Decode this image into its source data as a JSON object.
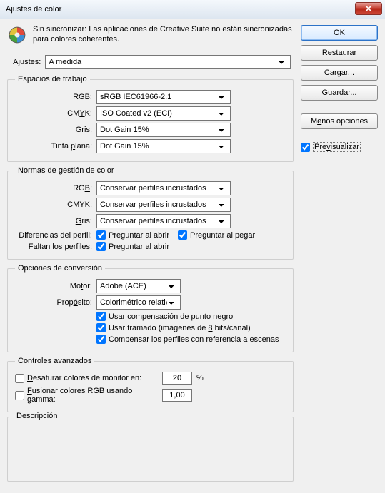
{
  "window": {
    "title": "Ajustes de color"
  },
  "sync": {
    "text": "Sin sincronizar: Las aplicaciones de Creative Suite no están sincronizadas para colores coherentes."
  },
  "settings": {
    "label": "Ajustes:",
    "value": "A medida"
  },
  "workspaces": {
    "legend": "Espacios de trabajo",
    "rows": {
      "rgb": {
        "label": "RGB:",
        "value": "sRGB IEC61966-2.1"
      },
      "cmyk": {
        "label_pre": "CM",
        "label_u": "Y",
        "label_post": "K:",
        "value": "ISO Coated v2 (ECI)"
      },
      "gris": {
        "label_pre": "Gr",
        "label_u": "i",
        "label_post": "s:",
        "value": "Dot Gain 15%"
      },
      "tinta": {
        "label_pre": "Tinta ",
        "label_u": "p",
        "label_post": "lana:",
        "value": "Dot Gain 15%"
      }
    }
  },
  "policies": {
    "legend": "Normas de gestión de color",
    "rows": {
      "rgb": {
        "label_pre": "RG",
        "label_u": "B",
        "label_post": ":",
        "value": "Conservar perfiles incrustados"
      },
      "cmyk": {
        "label_pre": "C",
        "label_u": "M",
        "label_post": "YK:",
        "value": "Conservar perfiles incrustados"
      },
      "gris": {
        "label_pre": "",
        "label_u": "G",
        "label_post": "ris:",
        "value": "Conservar perfiles incrustados"
      }
    },
    "mismatch_label": "Diferencias del perfil:",
    "missing_label": "Faltan los perfiles:",
    "ask_open": "Preguntar al abrir",
    "ask_paste": "Preguntar al pegar"
  },
  "conversion": {
    "legend": "Opciones de conversión",
    "engine": {
      "label_pre": "Mo",
      "label_u": "t",
      "label_post": "or:",
      "value": "Adobe (ACE)"
    },
    "intent": {
      "label_pre": "Prop",
      "label_u": "ó",
      "label_post": "sito:",
      "value": "Colorimétrico relativo"
    },
    "bpc_pre": "Usar compensación de punto ",
    "bpc_u": "n",
    "bpc_post": "egro",
    "dither_pre": "Usar tramado (imágenes de ",
    "dither_u": "8",
    "dither_post": " bits/canal)",
    "scene": "Compensar los perfiles con referencia a escenas"
  },
  "advanced": {
    "legend": "Controles avanzados",
    "desat_pre": "",
    "desat_u": "D",
    "desat_post": "esaturar colores de monitor en:",
    "desat_val": "20",
    "desat_pct": "%",
    "blend_pre": "",
    "blend_u": "F",
    "blend_post": "usionar colores RGB usando gamma:",
    "blend_val": "1,00"
  },
  "description": {
    "legend": "Descripción"
  },
  "buttons": {
    "ok": "OK",
    "restore": "Restaurar",
    "load_pre": "",
    "load_u": "C",
    "load_post": "argar...",
    "save_pre": "G",
    "save_u": "u",
    "save_post": "ardar...",
    "less_pre": "M",
    "less_u": "e",
    "less_post": "nos opciones",
    "preview_pre": "Pre",
    "preview_u": "v",
    "preview_post": "isualizar"
  }
}
